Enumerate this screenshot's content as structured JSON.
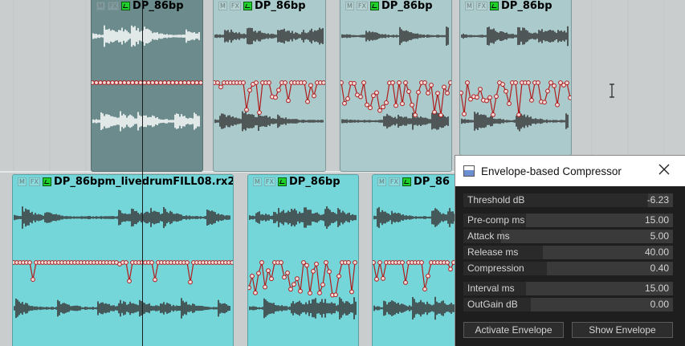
{
  "colors": {
    "arrange_bg": "#c9cdcd",
    "item_selected": "#6b8b8d",
    "item_light": "#aacacc",
    "item_cyan": "#75d6da",
    "waveform_dark": "#3a3a3a",
    "waveform_white": "#ffffff",
    "envelope": "#b01c1c"
  },
  "icons": {
    "item_fx": "fx-chain-icon",
    "dialog_app": "window-app-icon",
    "dialog_close": "close-x-icon",
    "mouse": "ibeam-cursor-icon"
  },
  "items": [
    {
      "name": "DP_86bp",
      "tags": [
        "M",
        "FX"
      ]
    },
    {
      "name": "DP_86bp",
      "tags": [
        "M",
        "FX"
      ]
    },
    {
      "name": "DP_86bp",
      "tags": [
        "M",
        "FX"
      ]
    },
    {
      "name": "DP_86bp",
      "tags": [
        "M",
        "FX"
      ]
    },
    {
      "name": "DP_86bpm_livedrumFILL08.rx2",
      "tags": [
        "M",
        "FX"
      ]
    },
    {
      "name": "DP_86bp",
      "tags": [
        "M",
        "FX"
      ]
    },
    {
      "name": "DP_86",
      "tags": [
        "M",
        "FX"
      ]
    }
  ],
  "dialog": {
    "title": "Envelope-based Compressor",
    "sliders": [
      {
        "label": "Threshold dB",
        "value": "-6.23",
        "level": 0.88
      },
      {
        "label": "Pre-comp ms",
        "value": "15.00",
        "level": 0.3
      },
      {
        "label": "Attack ms",
        "value": "5.00",
        "level": 0.18
      },
      {
        "label": "Release ms",
        "value": "40.00",
        "level": 0.38
      },
      {
        "label": "Compression",
        "value": "0.40",
        "level": 0.4
      },
      {
        "label": "Interval ms",
        "value": "15.00",
        "level": 0.3
      },
      {
        "label": "OutGain dB",
        "value": "0.00",
        "level": 0.32
      }
    ],
    "buttons": {
      "activate": "Activate Envelope",
      "show": "Show Envelope"
    }
  }
}
